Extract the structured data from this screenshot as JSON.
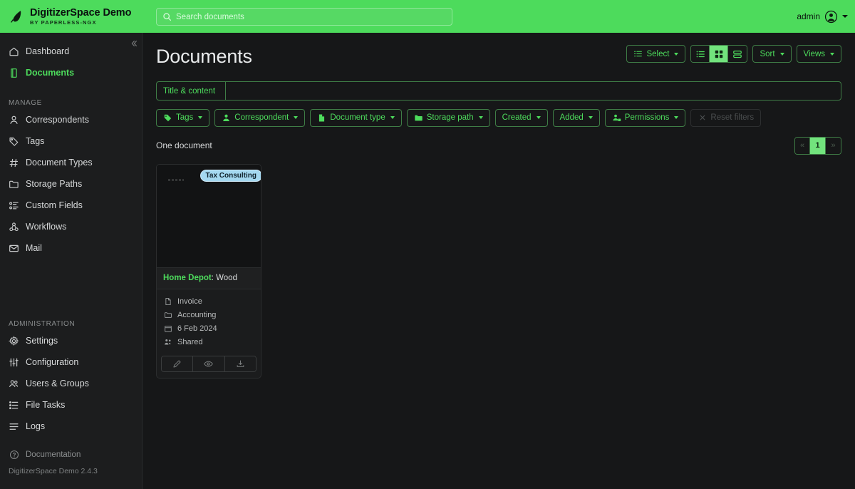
{
  "app": {
    "brand_title": "DigitizerSpace Demo",
    "brand_subtitle": "BY PAPERLESS-NGX",
    "logo_icon": "feather-icon",
    "version": "DigitizerSpace Demo 2.4.3"
  },
  "search": {
    "placeholder": "Search documents",
    "value": "",
    "icon": "search-icon"
  },
  "user": {
    "name": "admin",
    "avatar_icon": "user-circle-icon",
    "caret_icon": "chevron-down-icon"
  },
  "sidebar": {
    "collapse_icon": "double-chevron-left-icon",
    "primary": [
      {
        "label": "Dashboard",
        "icon": "home-icon",
        "active": false
      },
      {
        "label": "Documents",
        "icon": "file-stack-icon",
        "active": true
      }
    ],
    "manage_section": "MANAGE",
    "manage": [
      {
        "label": "Correspondents",
        "icon": "person-icon"
      },
      {
        "label": "Tags",
        "icon": "tag-icon"
      },
      {
        "label": "Document Types",
        "icon": "hash-icon"
      },
      {
        "label": "Storage Paths",
        "icon": "folder-icon"
      },
      {
        "label": "Custom Fields",
        "icon": "list-fields-icon"
      },
      {
        "label": "Workflows",
        "icon": "workflow-icon"
      },
      {
        "label": "Mail",
        "icon": "envelope-icon"
      }
    ],
    "admin_section": "ADMINISTRATION",
    "admin": [
      {
        "label": "Settings",
        "icon": "gear-icon"
      },
      {
        "label": "Configuration",
        "icon": "sliders-icon"
      },
      {
        "label": "Users & Groups",
        "icon": "people-icon"
      },
      {
        "label": "File Tasks",
        "icon": "task-list-icon"
      },
      {
        "label": "Logs",
        "icon": "lines-icon"
      }
    ],
    "documentation": {
      "label": "Documentation",
      "icon": "question-circle-icon"
    }
  },
  "page": {
    "title": "Documents"
  },
  "toolbar": {
    "select_label": "Select",
    "select_icon": "select-list-icon",
    "views": [
      {
        "name": "list-view",
        "icon": "list-icon",
        "active": false
      },
      {
        "name": "grid-view",
        "icon": "grid-icon",
        "active": true
      },
      {
        "name": "details-view",
        "icon": "rows-icon",
        "active": false
      }
    ],
    "sort_label": "Sort",
    "views_label": "Views"
  },
  "filters": {
    "mode_label": "Title & content",
    "text_value": "",
    "text_placeholder": "",
    "chips": [
      {
        "label": "Tags",
        "icon": "tag-icon",
        "disabled": false
      },
      {
        "label": "Correspondent",
        "icon": "person-icon",
        "disabled": false
      },
      {
        "label": "Document type",
        "icon": "file-icon",
        "disabled": false
      },
      {
        "label": "Storage path",
        "icon": "folder-icon",
        "disabled": false
      },
      {
        "label": "Created",
        "icon": "",
        "disabled": false
      },
      {
        "label": "Added",
        "icon": "",
        "disabled": false
      },
      {
        "label": "Permissions",
        "icon": "permissions-icon",
        "disabled": false
      }
    ],
    "reset": {
      "label": "Reset filters",
      "icon": "x-icon",
      "disabled": true
    }
  },
  "results": {
    "count_label": "One document",
    "pagination": {
      "prev": "«",
      "pages": [
        "1"
      ],
      "current": "1",
      "next": "»"
    }
  },
  "documents": [
    {
      "tag": "Tax Consulting",
      "tag_color": "#a4d8f0",
      "correspondent": "Home Depot",
      "title_separator": ": ",
      "title": "Wood",
      "document_type": "Invoice",
      "storage_path": "Accounting",
      "created": "6 Feb 2024",
      "permissions": "Shared",
      "actions": [
        {
          "name": "edit-button",
          "icon": "pencil-icon"
        },
        {
          "name": "preview-button",
          "icon": "eye-icon"
        },
        {
          "name": "download-button",
          "icon": "download-icon"
        }
      ]
    }
  ],
  "colors": {
    "accent_green": "#4ddb5c",
    "topbar_green": "#4ddb5c",
    "sidebar_bg": "#1c1d1e",
    "main_bg": "#161718",
    "tag_blue": "#a4d8f0"
  }
}
